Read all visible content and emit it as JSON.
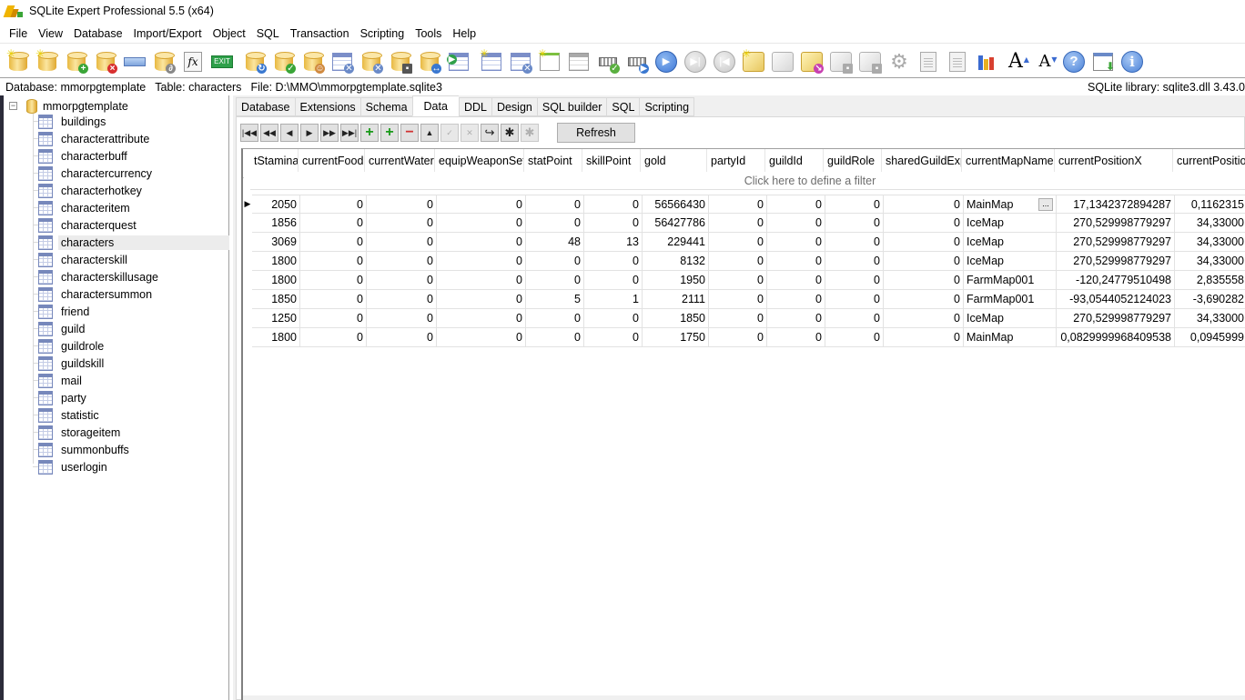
{
  "window": {
    "title": "SQLite Expert Professional 5.5 (x64)"
  },
  "menu": [
    "File",
    "View",
    "Database",
    "Import/Export",
    "Object",
    "SQL",
    "Transaction",
    "Scripting",
    "Tools",
    "Help"
  ],
  "toolbar": {
    "buttons": [
      "new-database-icon",
      "new-memory-database-icon",
      "attach-database-icon",
      "detach-database-icon",
      "rename-icon",
      "attach-file-icon",
      "function-icon",
      "exit-icon",
      "refresh-database-icon",
      "check-database-icon",
      "database-user-icon",
      "table-tools-icon",
      "database-tools-icon",
      "save-database-icon",
      "compare-database-icon",
      "import-table-icon",
      "new-table-icon",
      "design-table-icon",
      "new-view-icon",
      "edit-view-icon",
      "commit-icon",
      "execute-icon",
      "play-icon",
      "step-icon",
      "step-back-icon",
      "new-script-icon",
      "edit-script-icon",
      "run-script-icon",
      "save-script-icon",
      "save-script-as-icon",
      "options-icon",
      "copy-icon",
      "paste-icon",
      "chart-icon",
      "font-increase-icon",
      "font-decrease-icon",
      "help-icon",
      "download-icon",
      "info-icon"
    ],
    "exit_label": "EXIT",
    "fx_label": "fx"
  },
  "infobar": {
    "database": "Database: mmorpgtemplate",
    "table": "Table: characters",
    "file": "File: D:\\MMO\\mmorpgtemplate.sqlite3",
    "library": "SQLite library: sqlite3.dll 3.43.0"
  },
  "tree": {
    "root": "mmorpgtemplate",
    "selected": "characters",
    "tables": [
      "buildings",
      "characterattribute",
      "characterbuff",
      "charactercurrency",
      "characterhotkey",
      "characteritem",
      "characterquest",
      "characters",
      "characterskill",
      "characterskillusage",
      "charactersummon",
      "friend",
      "guild",
      "guildrole",
      "guildskill",
      "mail",
      "party",
      "statistic",
      "storageitem",
      "summonbuffs",
      "userlogin"
    ]
  },
  "tabs": {
    "items": [
      "Database",
      "Extensions",
      "Schema",
      "Data",
      "DDL",
      "Design",
      "SQL builder",
      "SQL",
      "Scripting"
    ],
    "active": "Data"
  },
  "nav": {
    "buttons": [
      "first",
      "prior-page",
      "prior",
      "next",
      "next-page",
      "last",
      "insert",
      "append",
      "delete",
      "edit",
      "post",
      "cancel",
      "refresh-record",
      "apply-updates",
      "cancel-updates"
    ],
    "refresh_label": "Refresh"
  },
  "grid": {
    "filter_placeholder": "Click here to define a filter",
    "columns": [
      "tStamina",
      "currentFood",
      "currentWater",
      "equipWeaponSet",
      "statPoint",
      "skillPoint",
      "gold",
      "partyId",
      "guildId",
      "guildRole",
      "sharedGuildExp",
      "currentMapName",
      "currentPositionX",
      "currentPositio"
    ],
    "rows": [
      [
        "2050",
        "0",
        "0",
        "0",
        "0",
        "0",
        "56566430",
        "0",
        "0",
        "0",
        "0",
        "MainMap",
        "17,1342372894287",
        "0,1162315"
      ],
      [
        "1856",
        "0",
        "0",
        "0",
        "0",
        "0",
        "56427786",
        "0",
        "0",
        "0",
        "0",
        "IceMap",
        "270,529998779297",
        "34,33000"
      ],
      [
        "3069",
        "0",
        "0",
        "0",
        "48",
        "13",
        "229441",
        "0",
        "0",
        "0",
        "0",
        "IceMap",
        "270,529998779297",
        "34,33000"
      ],
      [
        "1800",
        "0",
        "0",
        "0",
        "0",
        "0",
        "8132",
        "0",
        "0",
        "0",
        "0",
        "IceMap",
        "270,529998779297",
        "34,33000"
      ],
      [
        "1800",
        "0",
        "0",
        "0",
        "0",
        "0",
        "1950",
        "0",
        "0",
        "0",
        "0",
        "FarmMap001",
        "-120,24779510498",
        "2,835558"
      ],
      [
        "1850",
        "0",
        "0",
        "0",
        "5",
        "1",
        "2111",
        "0",
        "0",
        "0",
        "0",
        "FarmMap001",
        "-93,0544052124023",
        "-3,690282"
      ],
      [
        "1250",
        "0",
        "0",
        "0",
        "0",
        "0",
        "1850",
        "0",
        "0",
        "0",
        "0",
        "IceMap",
        "270,529998779297",
        "34,33000"
      ],
      [
        "1800",
        "0",
        "0",
        "0",
        "0",
        "0",
        "1750",
        "0",
        "0",
        "0",
        "0",
        "MainMap",
        "0,0829999968409538",
        "0,0945999"
      ]
    ],
    "current_row": 0,
    "ellipsis_label": "..."
  }
}
